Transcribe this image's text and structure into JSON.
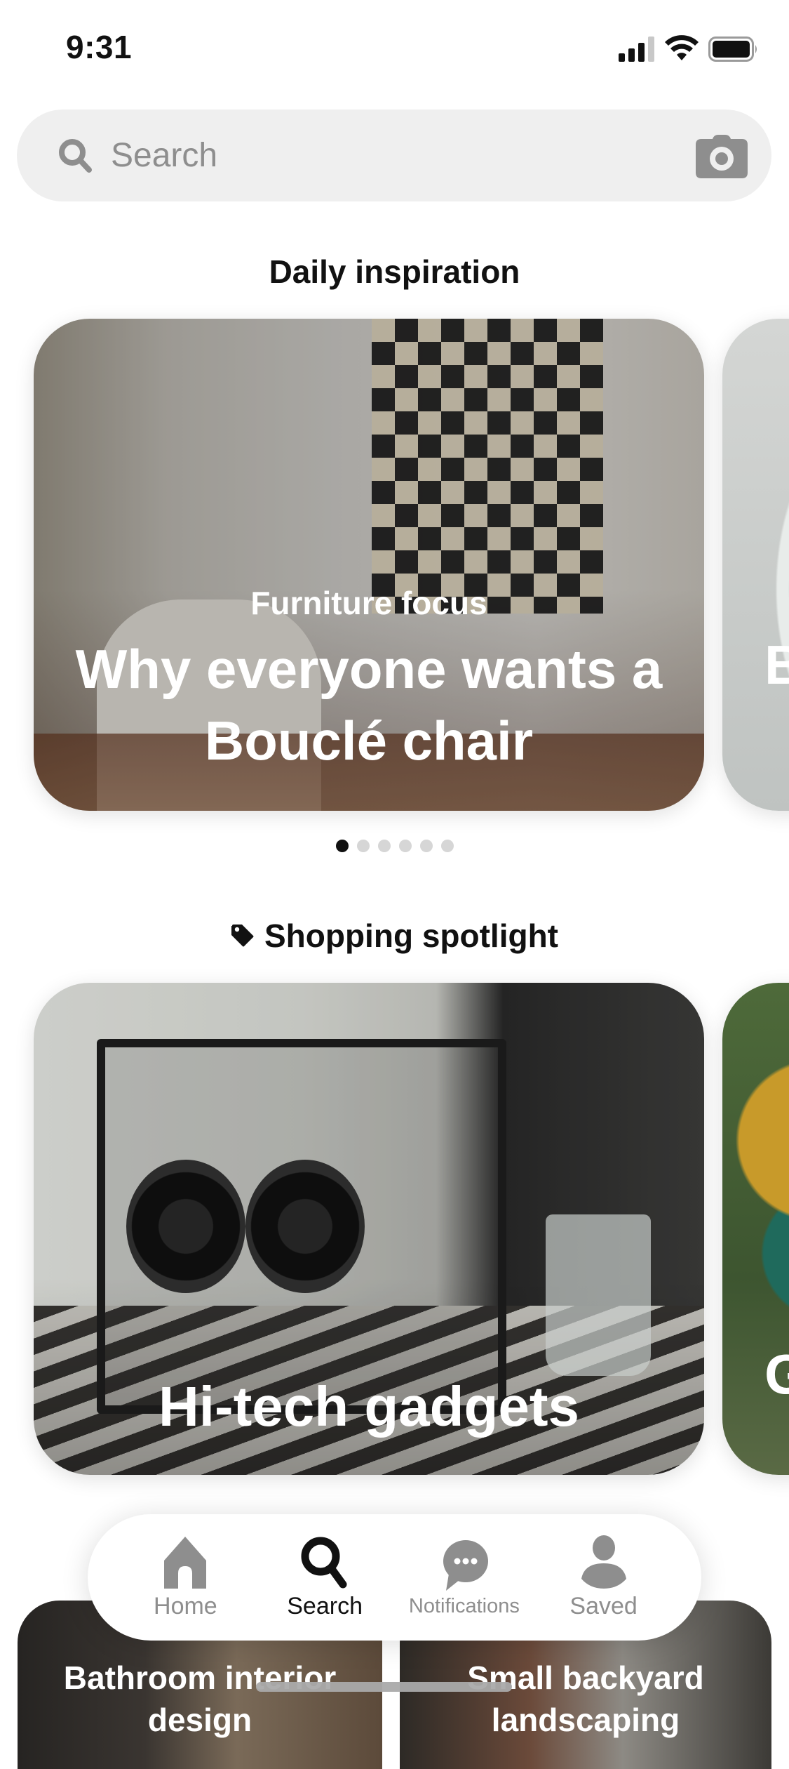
{
  "status_bar": {
    "time": "9:31",
    "signal_bars_active": 3,
    "signal_bars_total": 4,
    "icons": [
      "cellular-signal-icon",
      "wifi-icon",
      "battery-icon"
    ]
  },
  "search": {
    "placeholder": "Search",
    "value": "",
    "left_icon": "search-icon",
    "right_icon": "camera-icon"
  },
  "daily_inspiration": {
    "heading": "Daily inspiration",
    "cards": [
      {
        "subtitle": "Furniture focus",
        "title": "Why everyone wants a Bouclé chair"
      },
      {
        "subtitle": "",
        "title": "B"
      }
    ],
    "pagination": {
      "total": 6,
      "active_index": 0
    }
  },
  "shopping_spotlight": {
    "heading": "Shopping spotlight",
    "heading_icon": "tag-icon",
    "cards": [
      {
        "title": "Hi-tech gadgets"
      },
      {
        "title": "G"
      }
    ]
  },
  "tiles": [
    {
      "title": "Bathroom interior design"
    },
    {
      "title": "Small backyard landscaping"
    }
  ],
  "bottom_nav": {
    "active": "Search",
    "items": [
      {
        "label": "Home",
        "icon": "home-icon"
      },
      {
        "label": "Search",
        "icon": "search-icon"
      },
      {
        "label": "Notifications",
        "icon": "chat-bubble-icon"
      },
      {
        "label": "Saved",
        "icon": "person-icon"
      }
    ]
  },
  "colors": {
    "accent_active": "#111111",
    "inactive": "#8e8e8e",
    "search_bg": "#efefef",
    "dot_inactive": "#d6d6d6"
  }
}
